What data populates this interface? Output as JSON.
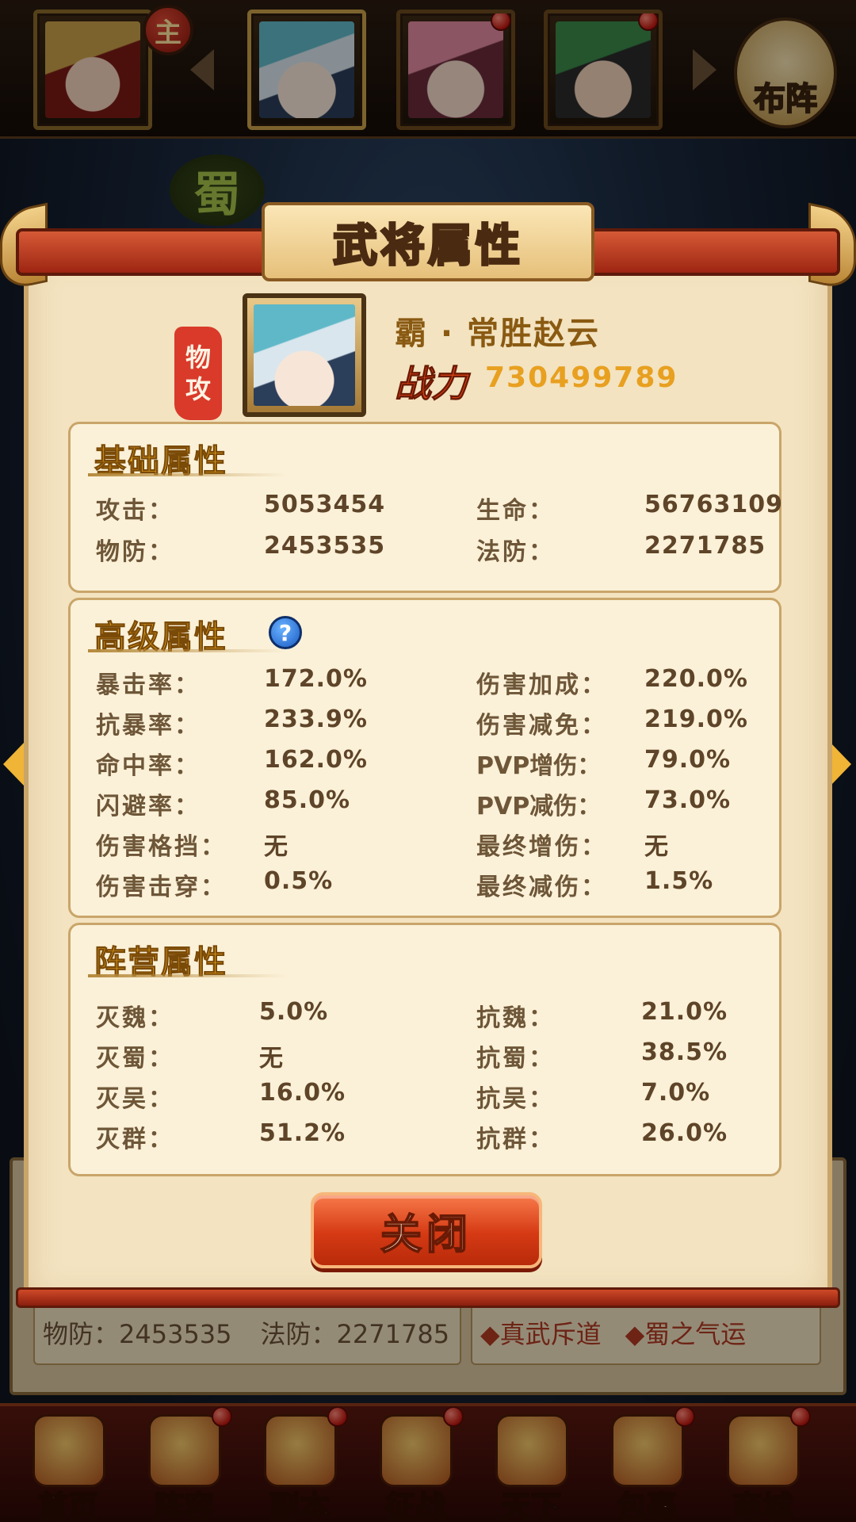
{
  "top_bar": {
    "lord_badge": "主",
    "formation_label": "布阵"
  },
  "background": {
    "faction_emblem": "蜀",
    "under_panel": {
      "phys_def": "物防：2453535",
      "mag_def": "法防：2271785",
      "skill_1": "◆真武斥道",
      "skill_2": "◆蜀之气运"
    }
  },
  "modal": {
    "title": "武将属性",
    "class_seal": [
      "物",
      "攻"
    ],
    "hero_name": "霸 · 常胜赵云",
    "power_label": "战力",
    "power_value": "730499789",
    "close_label": "关闭"
  },
  "basic": {
    "title": "基础属性",
    "rows": [
      {
        "k1": "攻击：",
        "v1": "5053454",
        "k2": "生命：",
        "v2": "56763109"
      },
      {
        "k1": "物防：",
        "v1": "2453535",
        "k2": "法防：",
        "v2": "2271785"
      }
    ]
  },
  "advanced": {
    "title": "高级属性",
    "help_icon": "?",
    "rows": [
      {
        "k1": "暴击率：",
        "v1": "172.0%",
        "k2": "伤害加成：",
        "v2": "220.0%"
      },
      {
        "k1": "抗暴率：",
        "v1": "233.9%",
        "k2": "伤害减免：",
        "v2": "219.0%"
      },
      {
        "k1": "命中率：",
        "v1": "162.0%",
        "k2": "PVP增伤：",
        "v2": "79.0%"
      },
      {
        "k1": "闪避率：",
        "v1": "85.0%",
        "k2": "PVP减伤：",
        "v2": "73.0%"
      },
      {
        "k1": "伤害格挡：",
        "v1": "无",
        "k2": "最终增伤：",
        "v2": "无"
      },
      {
        "k1": "伤害击穿：",
        "v1": "0.5%",
        "k2": "最终减伤：",
        "v2": "1.5%"
      }
    ]
  },
  "camp": {
    "title": "阵营属性",
    "rows": [
      {
        "k1": "灭魏：",
        "v1": "5.0%",
        "k2": "抗魏：",
        "v2": "21.0%"
      },
      {
        "k1": "灭蜀：",
        "v1": "无",
        "k2": "抗蜀：",
        "v2": "38.5%"
      },
      {
        "k1": "灭吴：",
        "v1": "16.0%",
        "k2": "抗吴：",
        "v2": "7.0%"
      },
      {
        "k1": "灭群：",
        "v1": "51.2%",
        "k2": "抗群：",
        "v2": "26.0%"
      }
    ]
  },
  "bottom_nav": [
    {
      "label": "首页",
      "icon": "home-icon"
    },
    {
      "label": "阵容",
      "icon": "lineup-icon"
    },
    {
      "label": "副本",
      "icon": "dungeon-icon"
    },
    {
      "label": "征战",
      "icon": "campaign-icon"
    },
    {
      "label": "天下",
      "icon": "world-icon"
    },
    {
      "label": "包裹",
      "icon": "bag-icon"
    },
    {
      "label": "商城",
      "icon": "shop-icon"
    }
  ],
  "colors": {
    "accent_gold": "#e6a21c",
    "panel_bg": "#f3e3c0",
    "power_red": "#e9471a",
    "close_button": "#d53a14"
  }
}
